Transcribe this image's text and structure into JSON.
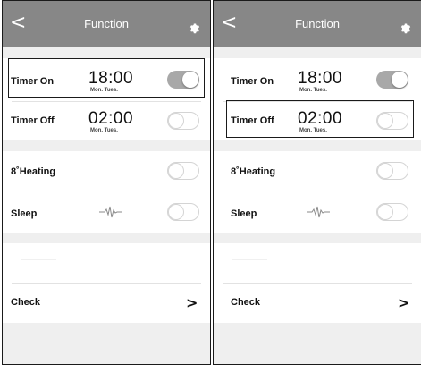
{
  "header": {
    "back_glyph": "<",
    "title": "Function",
    "settings_icon": "gear-icon"
  },
  "timer_on": {
    "label": "Timer On",
    "time": "18:00",
    "days": "Mon. Tues.",
    "enabled": true
  },
  "timer_off": {
    "label": "Timer Off",
    "time": "02:00",
    "days": "Mon. Tues.",
    "enabled": false
  },
  "heating": {
    "label": "8˚Heating",
    "enabled": false
  },
  "sleep": {
    "label": "Sleep",
    "icon": "waveform-icon",
    "enabled": false
  },
  "check": {
    "label": "Check",
    "chevron": ">"
  },
  "colors": {
    "header": "#878787",
    "divider": "#efefef",
    "toggle_on": "#a8a8a8"
  },
  "highlights": {
    "left_screen": "timer-on-row",
    "right_screen": "timer-off-row"
  }
}
